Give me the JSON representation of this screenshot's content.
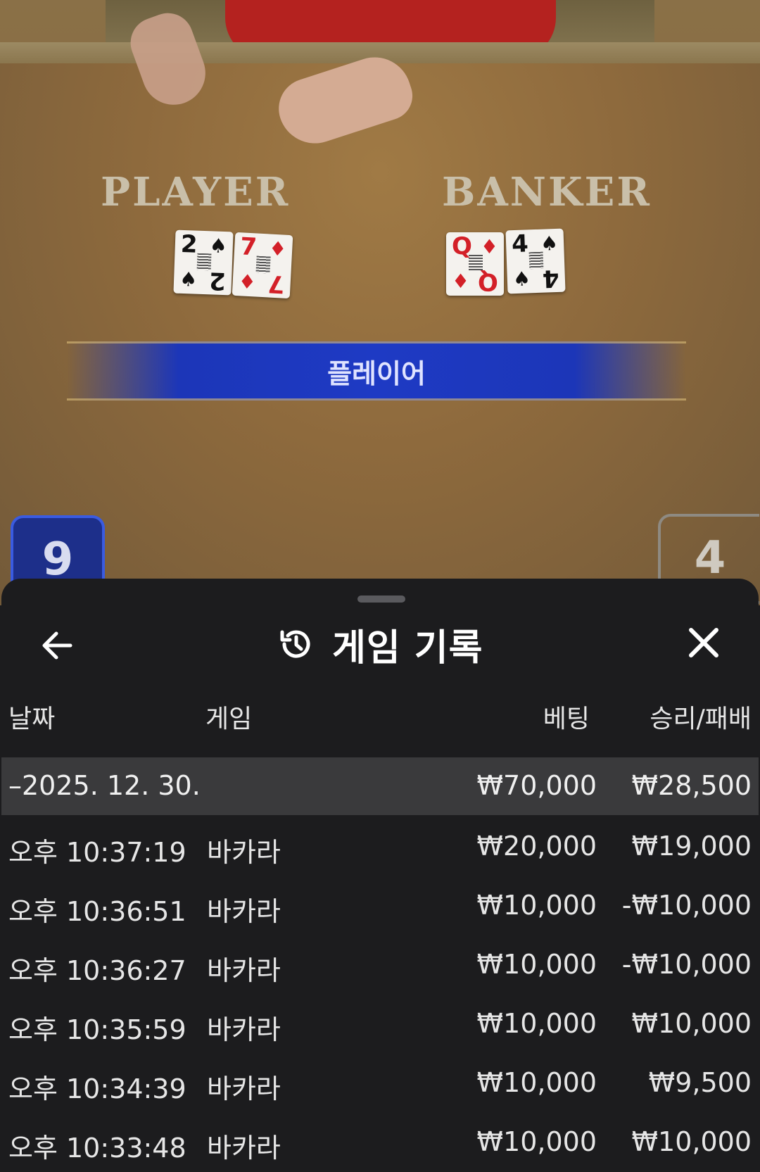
{
  "video": {
    "player_label": "PLAYER",
    "banker_label": "BANKER",
    "player_cards": [
      {
        "rank": "2",
        "suit": "♠",
        "color": "black"
      },
      {
        "rank": "7",
        "suit": "♦",
        "color": "red"
      }
    ],
    "banker_cards": [
      {
        "rank": "Q",
        "suit": "♦",
        "color": "red"
      },
      {
        "rank": "4",
        "suit": "♠",
        "color": "black"
      }
    ],
    "result_text": "플레이어",
    "player_score": "9",
    "banker_score": "4"
  },
  "sheet": {
    "title": "게임 기록",
    "title_icon": "history-icon",
    "back_icon": "arrow-left-icon",
    "close_icon": "close-icon",
    "columns": {
      "date": "날짜",
      "game": "게임",
      "bet": "베팅",
      "winloss": "승리/패배"
    },
    "group": {
      "date": "–2025. 12. 30.",
      "bet": "₩70,000",
      "winloss": "₩28,500"
    },
    "rows": [
      {
        "time": "오후 10:37:19",
        "game": "바카라",
        "bet": "₩20,000",
        "winloss": "₩19,000"
      },
      {
        "time": "오후 10:36:51",
        "game": "바카라",
        "bet": "₩10,000",
        "winloss": "-₩10,000"
      },
      {
        "time": "오후 10:36:27",
        "game": "바카라",
        "bet": "₩10,000",
        "winloss": "-₩10,000"
      },
      {
        "time": "오후 10:35:59",
        "game": "바카라",
        "bet": "₩10,000",
        "winloss": "₩10,000"
      },
      {
        "time": "오후 10:34:39",
        "game": "바카라",
        "bet": "₩10,000",
        "winloss": "₩9,500"
      },
      {
        "time": "오후 10:33:48",
        "game": "바카라",
        "bet": "₩10,000",
        "winloss": "₩10,000"
      }
    ]
  }
}
